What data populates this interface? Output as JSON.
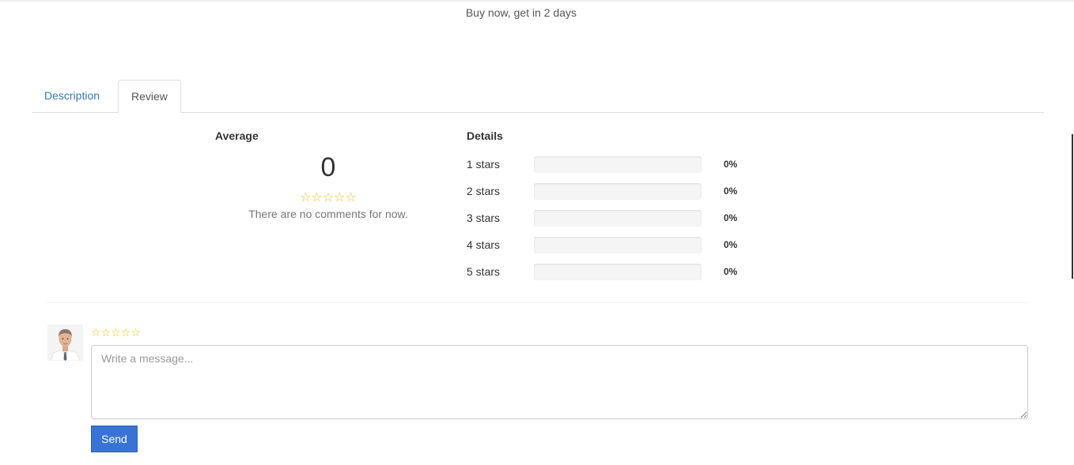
{
  "product": {
    "delivery_text": "Buy now, get in 2 days"
  },
  "tabs": [
    {
      "label": "Description",
      "active": false
    },
    {
      "label": "Review",
      "active": true
    }
  ],
  "review": {
    "average": {
      "title": "Average",
      "value": "0",
      "stars": "☆☆☆☆☆",
      "empty_text": "There are no comments for now."
    },
    "details": {
      "title": "Details",
      "rows": [
        {
          "label": "1 stars",
          "percent": "0%",
          "fill_fraction": 0
        },
        {
          "label": "2 stars",
          "percent": "0%",
          "fill_fraction": 0
        },
        {
          "label": "3 stars",
          "percent": "0%",
          "fill_fraction": 0
        },
        {
          "label": "4 stars",
          "percent": "0%",
          "fill_fraction": 0
        },
        {
          "label": "5 stars",
          "percent": "0%",
          "fill_fraction": 0
        }
      ]
    }
  },
  "comment_form": {
    "rating_stars": "☆☆☆☆☆",
    "message_placeholder": "Write a message...",
    "send_label": "Send"
  },
  "colors": {
    "link": "#337ab7",
    "star": "#f2c200",
    "send_button": "#3874d6"
  }
}
